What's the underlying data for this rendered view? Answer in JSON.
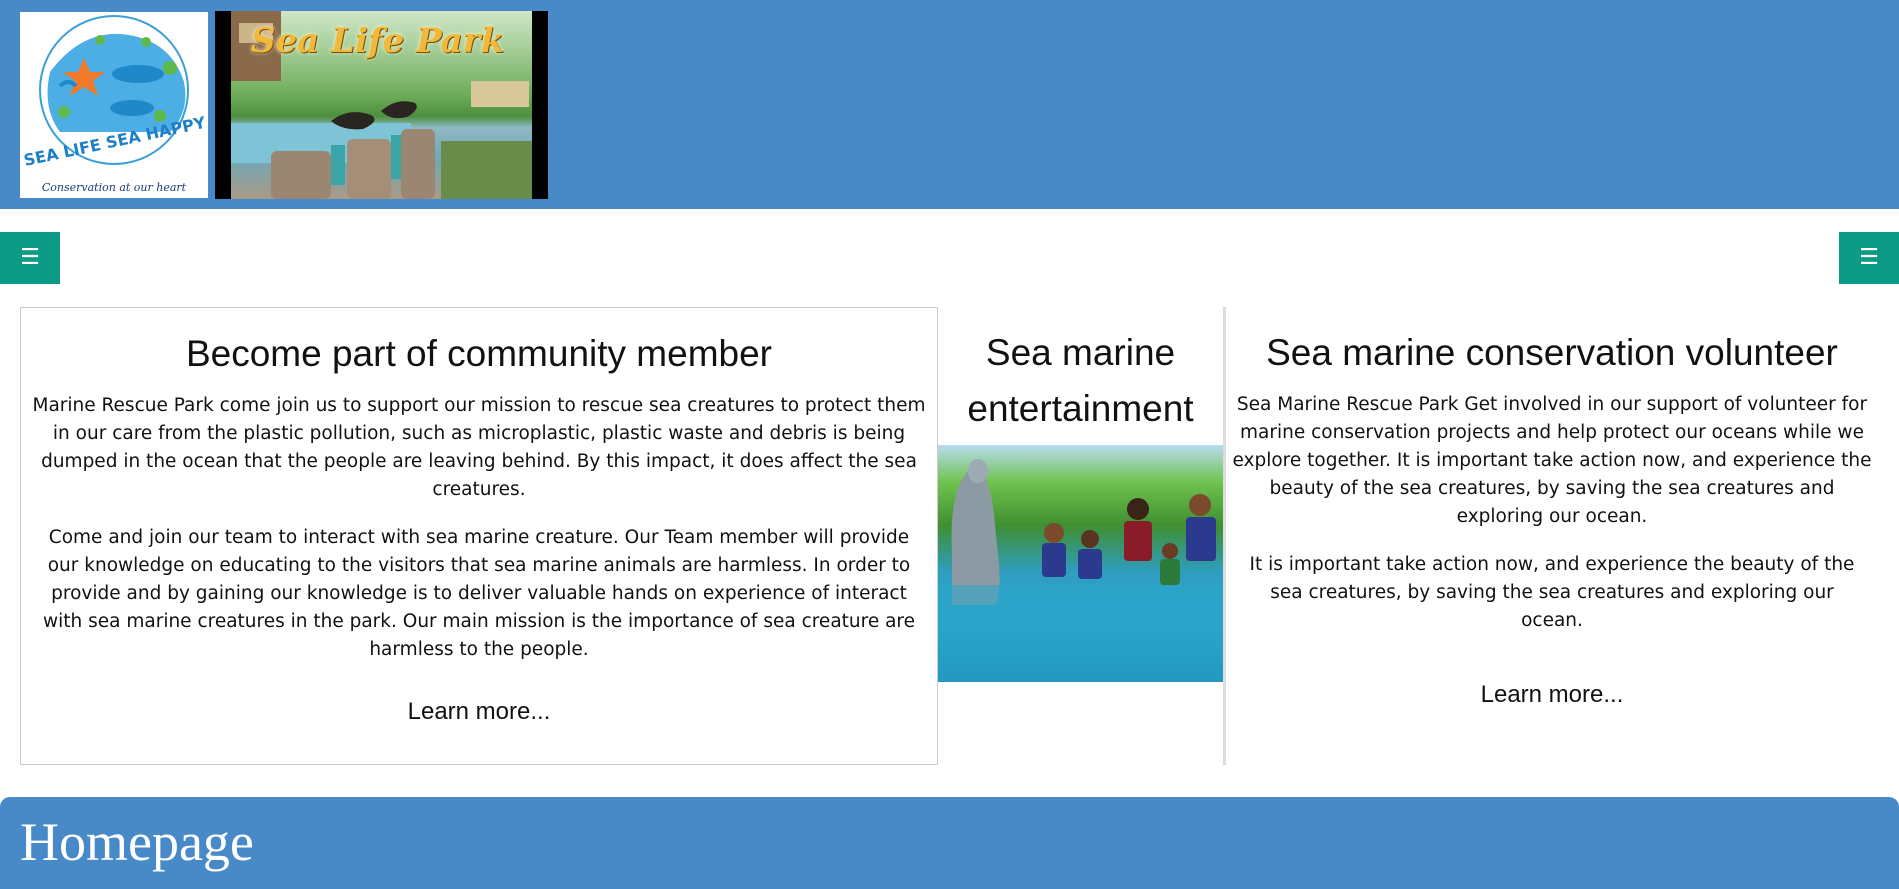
{
  "header": {
    "logo": {
      "icon": "sea-life-logo",
      "text_line1": "SEA LIFE SEA HAPPY",
      "tagline": "Conservation at our heart"
    },
    "banner": {
      "icon": "sea-life-park-photo",
      "title": "Sea Life Park"
    }
  },
  "nav": {
    "left_menu_icon": "☰",
    "right_menu_icon": "☰"
  },
  "cards": {
    "community": {
      "title": "Become part of community member",
      "paragraph1": "Marine Rescue Park come join us to support our mission to rescue sea creatures to protect them in our care from the plastic pollution, such as microplastic, plastic waste and debris is being dumped in the ocean that the people are leaving behind. By this impact, it does affect the sea creatures.",
      "paragraph2": "Come and join our team to interact with sea marine creature. Our Team member will provide our knowledge on educating to the visitors that sea marine animals are harmless. In order to provide and by gaining our knowledge is to deliver valuable hands on experience of interact with sea marine creatures in the park. Our main mission is the importance of sea creature are harmless to the people.",
      "link": "Learn more..."
    },
    "entertainment": {
      "title": "Sea marine entertainment",
      "image_icon": "dolphin-encounter-photo"
    },
    "volunteer": {
      "title": "Sea marine conservation volunteer",
      "paragraph1": "Sea Marine Rescue Park Get involved in our support of volunteer for marine conservation projects and help protect our oceans while we explore together. It is important take action now, and experience the beauty of the sea creatures, by saving the sea creatures and exploring our ocean.",
      "paragraph2": "It is important take action now, and experience the beauty of the sea creatures, by saving the sea creatures and exploring our ocean.",
      "link": "Learn more..."
    }
  },
  "footer": {
    "title": "Homepage"
  },
  "colors": {
    "header_blue": "#4889c8",
    "menu_teal": "#0b9a85",
    "text": "#111111"
  }
}
